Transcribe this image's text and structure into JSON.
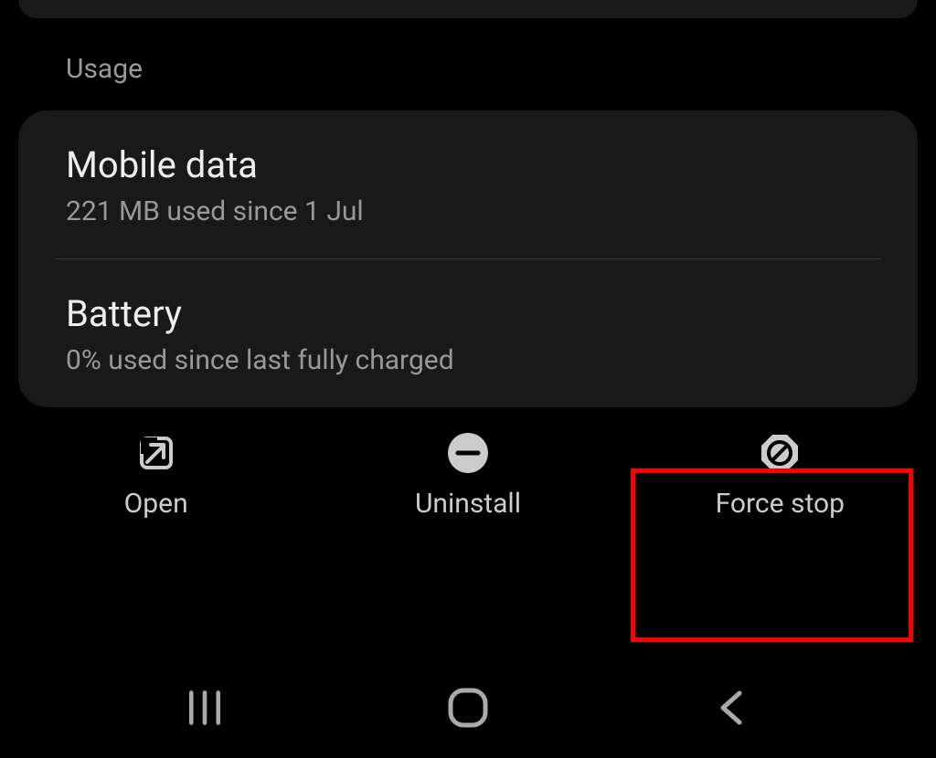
{
  "section_label": "Usage",
  "rows": {
    "mobile_data": {
      "title": "Mobile data",
      "sub": "221 MB used since 1 Jul"
    },
    "battery": {
      "title": "Battery",
      "sub": "0% used since last fully charged"
    }
  },
  "actions": {
    "open": "Open",
    "uninstall": "Uninstall",
    "force_stop": "Force stop"
  }
}
